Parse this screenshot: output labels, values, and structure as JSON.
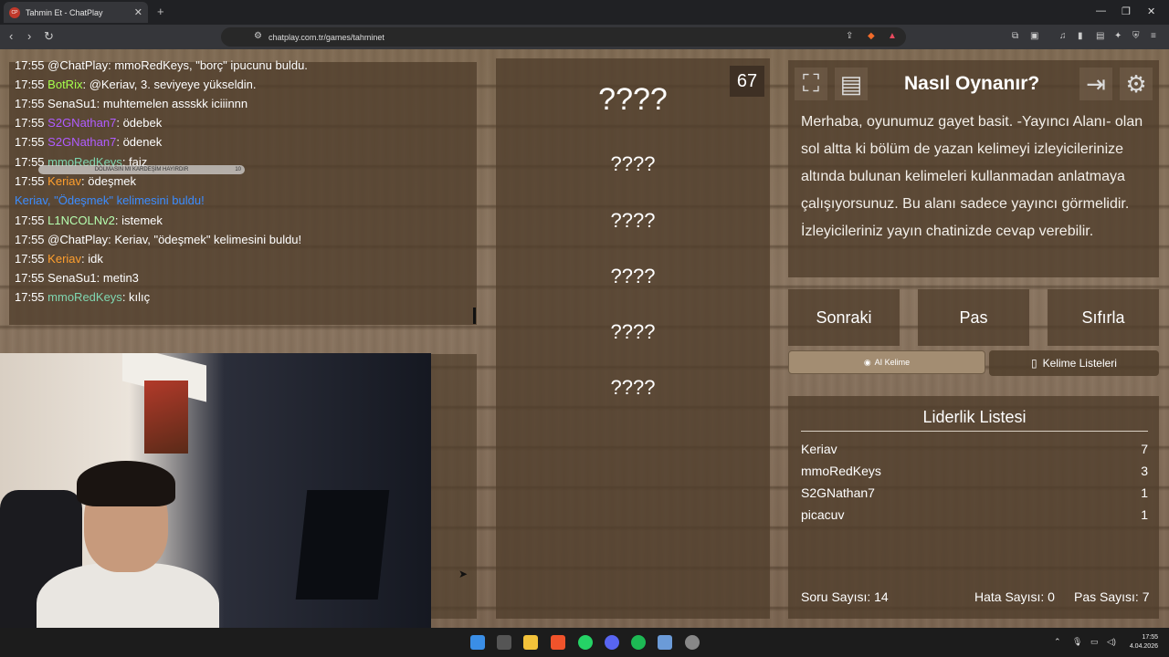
{
  "browser": {
    "tab_title": "Tahmin Et - ChatPlay",
    "tab_favicon": "CP",
    "url": "chatplay.com.tr/games/tahminet"
  },
  "chat": {
    "lines": [
      {
        "time": "17:55",
        "user": "@ChatPlay",
        "user_color": "#ffffff",
        "text": ": mmoRedKeys, \"borç\" ipucunu buldu."
      },
      {
        "time": "17:55",
        "user": "BotRix",
        "user_color": "#a6ff4d",
        "text": ": @Keriav, 3. seviyeye yükseldin."
      },
      {
        "time": "17:55",
        "user": "SenaSu1",
        "user_color": "#ffffff",
        "text": ": muhtemelen assskk iciiinnn"
      },
      {
        "time": "17:55",
        "user": "S2GNathan7",
        "user_color": "#b05cff",
        "text": ": ödebek"
      },
      {
        "time": "17:55",
        "user": "S2GNathan7",
        "user_color": "#b05cff",
        "text": ": ödenek"
      },
      {
        "time": "17:55",
        "user": "mmoRedKeys",
        "user_color": "#7fd6b0",
        "text": ": faiz"
      },
      {
        "time": "17:55",
        "user": "Keriav",
        "user_color": "#ff9f2e",
        "text": ": ödeşmek"
      },
      {
        "time": "",
        "user": "Keriav, \"Ödeşmek\" kelimesini buldu!",
        "user_color": "#3b8cff",
        "text": ""
      },
      {
        "time": "17:55",
        "user": "L1NCOLNv2",
        "user_color": "#b6ffb0",
        "text": ": istemek"
      },
      {
        "time": "17:55",
        "user": "@ChatPlay",
        "user_color": "#ffffff",
        "text": ": Keriav, \"ödeşmek\" kelimesini buldu!"
      },
      {
        "time": "17:55",
        "user": "Keriav",
        "user_color": "#ff9f2e",
        "text": ": idk"
      },
      {
        "time": "17:55",
        "user": "SenaSu1",
        "user_color": "#ffffff",
        "text": ": metin3"
      },
      {
        "time": "17:55",
        "user": "mmoRedKeys",
        "user_color": "#7fd6b0",
        "text": ": kılıç"
      }
    ],
    "overlay_text": "DOLMASIN MI KARDEŞİM HAYIRDIR",
    "overlay_num": "10"
  },
  "game": {
    "timer": "67",
    "words": [
      "????",
      "????",
      "????",
      "????",
      "????",
      "????"
    ]
  },
  "help": {
    "title": "Nasıl Oynanır?",
    "text": "Merhaba, oyunumuz gayet basit. -Yayıncı Alanı- olan sol altta ki bölüm de yazan kelimeyi izleyicilerinize altında bulunan kelimeleri kullanmadan anlatmaya çalışıyorsunuz. Bu alanı sadece yayıncı görmelidir. İzleyicileriniz yayın chatinizde cevap verebilir."
  },
  "controls": {
    "next": "Sonraki",
    "pass": "Pas",
    "reset": "Sıfırla",
    "ai_word": "AI Kelime",
    "word_lists": "Kelime Listeleri"
  },
  "leaderboard": {
    "title": "Liderlik Listesi",
    "rows": [
      {
        "name": "Keriav",
        "score": "7"
      },
      {
        "name": "mmoRedKeys",
        "score": "3"
      },
      {
        "name": "S2GNathan7",
        "score": "1"
      },
      {
        "name": "picacuv",
        "score": "1"
      }
    ]
  },
  "stats": {
    "questions": "Soru Sayısı: 14",
    "errors": "Hata Sayısı: 0",
    "passes": "Pas Sayısı: 7"
  },
  "taskbar": {
    "time": "17:55",
    "date": "4.04.2026"
  }
}
